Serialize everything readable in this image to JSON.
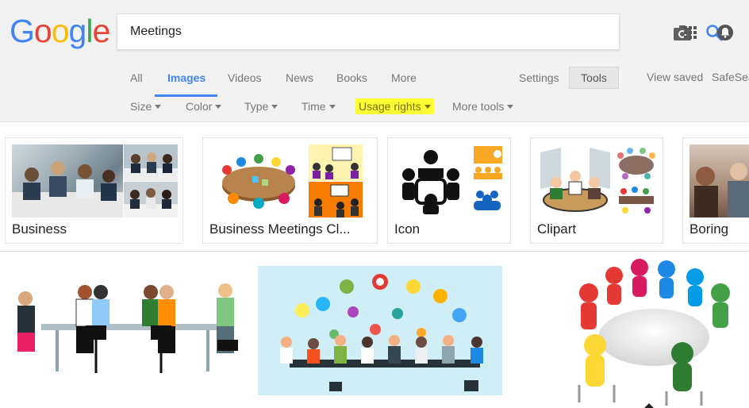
{
  "logo": {
    "letters": [
      "G",
      "o",
      "o",
      "g",
      "l",
      "e"
    ],
    "colors": [
      "#4285f4",
      "#ea4335",
      "#fbbc05",
      "#4285f4",
      "#34a853",
      "#ea4335"
    ]
  },
  "search": {
    "value": "Meetings",
    "placeholder": ""
  },
  "tabs": [
    {
      "label": "All",
      "active": false
    },
    {
      "label": "Images",
      "active": true
    },
    {
      "label": "Videos",
      "active": false
    },
    {
      "label": "News",
      "active": false
    },
    {
      "label": "Books",
      "active": false
    },
    {
      "label": "More",
      "active": false
    }
  ],
  "right_nav": {
    "settings": "Settings",
    "tools": "Tools",
    "view_saved": "View saved",
    "safesearch": "SafeSea"
  },
  "filters": [
    {
      "label": "Size",
      "highlighted": false
    },
    {
      "label": "Color",
      "highlighted": false
    },
    {
      "label": "Type",
      "highlighted": false
    },
    {
      "label": "Time",
      "highlighted": false
    },
    {
      "label": "Usage rights",
      "highlighted": true
    },
    {
      "label": "More tools",
      "highlighted": false
    }
  ],
  "suggestion_chips": [
    {
      "label": "Business"
    },
    {
      "label": "Business Meetings Cl..."
    },
    {
      "label": "Icon"
    },
    {
      "label": "Clipart"
    },
    {
      "label": "Boring"
    }
  ],
  "colors": {
    "accent": "#4285f4",
    "highlight": "#ffff33",
    "header_bg": "#f2f2f2"
  },
  "icons": [
    "camera-icon",
    "search-icon",
    "apps-grid-icon",
    "notifications-icon"
  ]
}
